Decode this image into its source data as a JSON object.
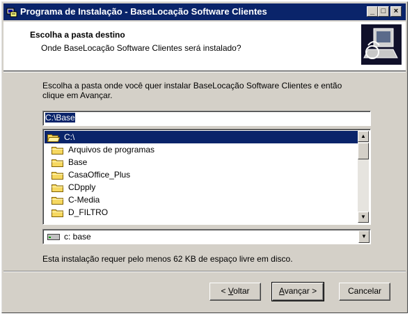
{
  "window": {
    "title": "Programa de Instalação - BaseLocação Software Clientes",
    "controls": {
      "minimize": "_",
      "maximize": "□",
      "close": "×"
    }
  },
  "header": {
    "title": "Escolha a pasta destino",
    "subtitle": "Onde BaseLocação Software Clientes será instalado?"
  },
  "body": {
    "description": "Escolha a pasta onde você quer instalar BaseLocação Software Clientes e então clique em Avançar.",
    "path_value": "C:\\Base",
    "folders": [
      {
        "label": "C:\\",
        "selected": true,
        "open": true
      },
      {
        "label": "Arquivos de programas",
        "selected": false
      },
      {
        "label": "Base",
        "selected": false
      },
      {
        "label": "CasaOffice_Plus",
        "selected": false
      },
      {
        "label": "CDpply",
        "selected": false
      },
      {
        "label": "C-Media",
        "selected": false
      },
      {
        "label": "D_FILTRO",
        "selected": false
      }
    ],
    "drive_value": "c: base",
    "space_required": "Esta instalação requer pelo menos 62 KB de espaço livre em disco."
  },
  "buttons": {
    "back": {
      "label": "Voltar",
      "prefix": "< ",
      "hotkey": "V"
    },
    "next": {
      "label": "Avançar",
      "suffix": " >",
      "hotkey": "A"
    },
    "cancel": {
      "label": "Cancelar"
    }
  },
  "colors": {
    "titlebar": "#0a246a",
    "dialog": "#d4d0c8",
    "selection": "#0a246a",
    "folder": "#f6d860"
  }
}
